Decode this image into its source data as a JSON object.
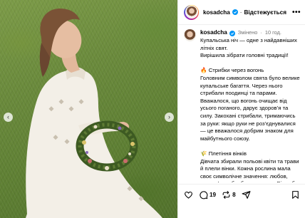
{
  "post": {
    "username": "kosadcha",
    "follow_label": "Відстежується",
    "more_label": "•••",
    "edited_label": "Змінено",
    "time_ago": "10 год.",
    "paragraphs": [
      "Купальська ніч — одне з найдавніших літніх свят.\nВирішила зібрати головні традиції!",
      "🔥 Стрибки через вогонь\nГоловним символом свята було велике купальське багаття. Через нього стрибали поодинці та парами. Вважалося, що вогонь очищає від усього поганого, дарує здоров’я та силу. Закохані стрибали, тримаючись за руки: якщо руки не роз’єднувалися — це вважалося добрим знаком для майбутнього союзу.",
      "🌾 Плетіння вінків\nДівчата збирали польові квіти та трави й плели вінки. Кожна рослина мала своє символічне значення: любов, здоров’я, добробут чи захист. Вінок був не лише прикрасою, а й"
    ]
  },
  "actions": {
    "comments_count": "19",
    "shares_count": "8"
  },
  "icons": {
    "avatar": "avatar",
    "verified": "verified-badge-icon",
    "heart": "heart-icon",
    "comment": "comment-icon",
    "repost": "repost-icon",
    "share": "share-icon",
    "bookmark": "bookmark-icon",
    "prev": "chevron-left-icon",
    "next": "chevron-right-icon"
  },
  "colors": {
    "verified_blue": "#0095f6",
    "meta_grey": "#737373",
    "grass_green": "#6a8a3c"
  }
}
